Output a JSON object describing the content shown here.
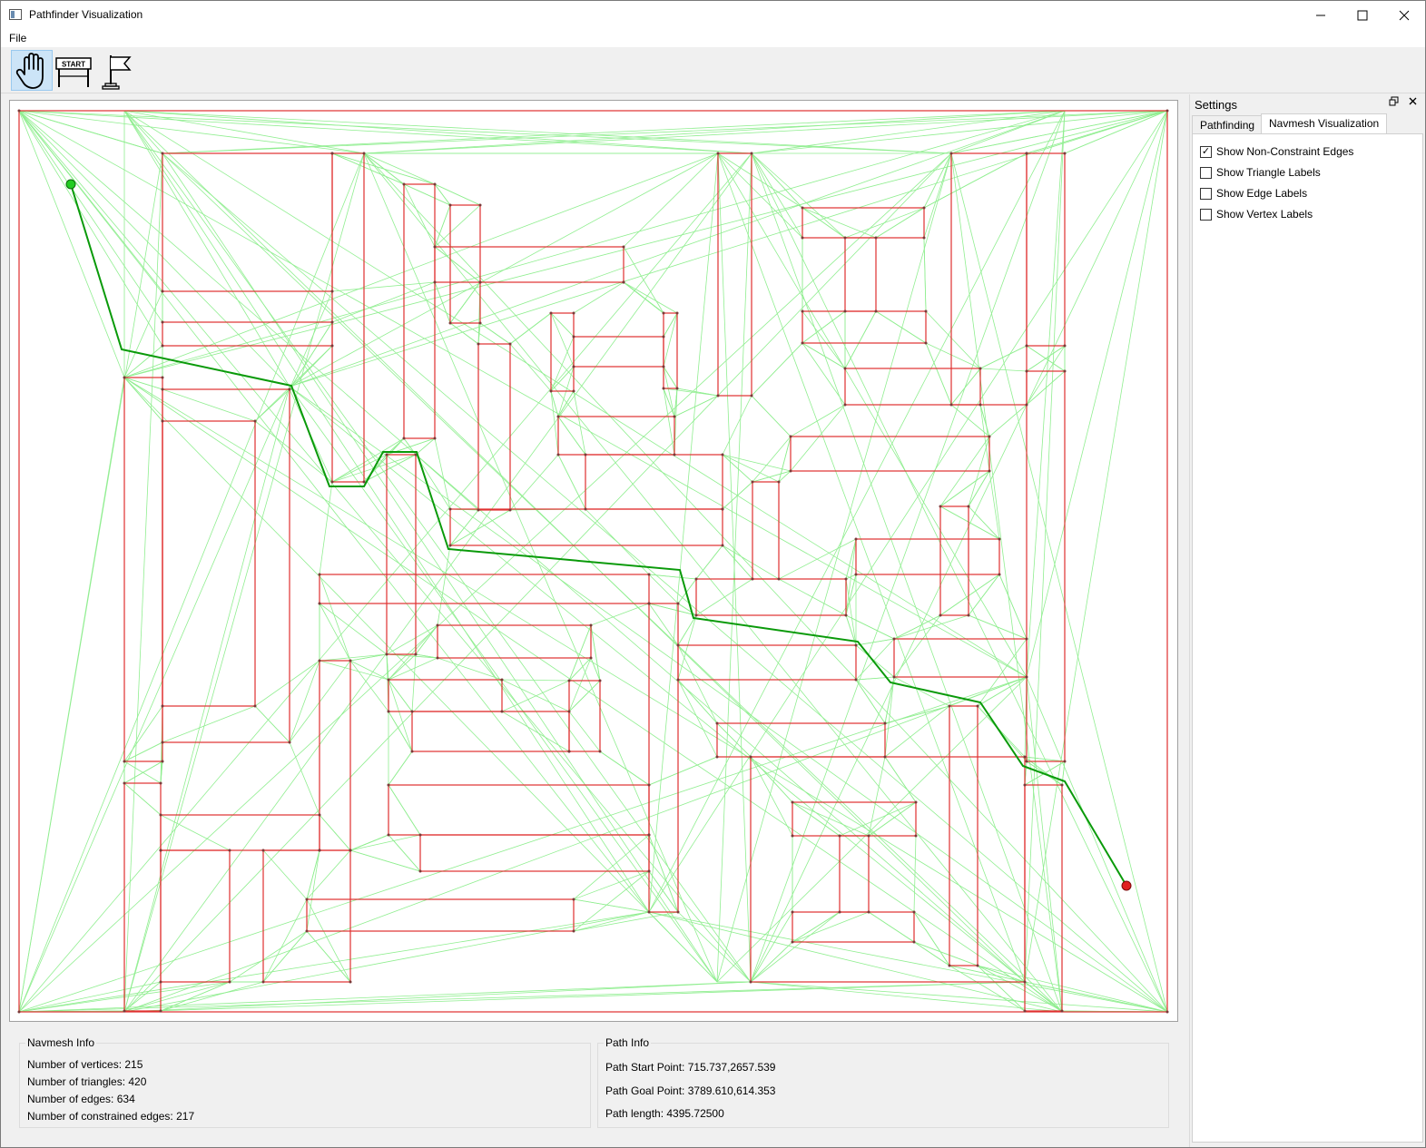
{
  "window": {
    "title": "Pathfinder Visualization"
  },
  "menu": {
    "file": "File"
  },
  "toolbar": {
    "tools": [
      {
        "name": "pan-tool",
        "icon": "hand-icon",
        "active": true
      },
      {
        "name": "start-tool",
        "icon": "start-sign-icon",
        "label": "START",
        "active": false
      },
      {
        "name": "goal-tool",
        "icon": "goal-flag-icon",
        "active": false
      }
    ]
  },
  "settings": {
    "title": "Settings",
    "tabs": {
      "pathfinding": "Pathfinding",
      "navmesh": "Navmesh Visualization"
    },
    "active_tab": "Navmesh Visualization",
    "checkboxes": [
      {
        "label": "Show Non-Constraint Edges",
        "checked": true
      },
      {
        "label": "Show Triangle Labels",
        "checked": false
      },
      {
        "label": "Show Edge Labels",
        "checked": false
      },
      {
        "label": "Show Vertex Labels",
        "checked": false
      }
    ]
  },
  "navmesh_info": {
    "title": "Navmesh Info",
    "vertices": "Number of vertices: 215",
    "triangles": "Number of triangles: 420",
    "edges": "Number of edges: 634",
    "constrained": "Number of constrained edges: 217"
  },
  "path_info": {
    "title": "Path Info",
    "start": "Path Start Point: 715.737,2657.539",
    "goal": "Path Goal Point: 3789.610,614.353",
    "length": "Path length: 4395.72500"
  },
  "colors": {
    "constraint": "#e03030",
    "mesh": "#90ee90",
    "path": "#0a9a0a",
    "start": "#22cc22",
    "goal": "#e02020"
  }
}
